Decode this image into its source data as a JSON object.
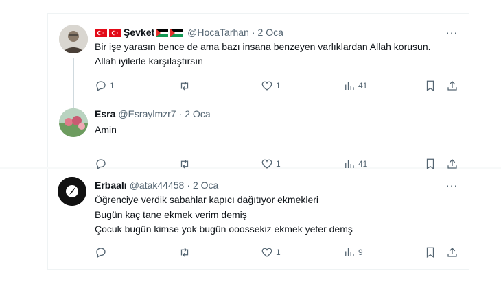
{
  "tweets": [
    {
      "name": "Şevket",
      "handle": "@HocaTarhan",
      "time": "2 Oca",
      "text": "Bir işe yarasın bence de ama bazı insana benzeyen varlıklardan Allah korusun. Allah iyilerle karşılaştırsın",
      "replies": "1",
      "retweets": "",
      "likes": "1",
      "views": "41",
      "more": "···"
    },
    {
      "name": "Esra",
      "handle": "@Esraylmzr7",
      "time": "2 Oca",
      "text": "Amin",
      "replies": "",
      "retweets": "",
      "likes": "1",
      "views": "41",
      "more": "···"
    },
    {
      "name": "Erbaalı",
      "handle": "@atak44458",
      "time": "2 Oca",
      "line1": "Öğrenciye verdik sabahlar kapıcı dağıtıyor ekmekleri",
      "line2": "Bugün kaç tane ekmek verim demiş",
      "line3": "Çocuk bugün kimse yok bugün ooossekiz ekmek yeter demş",
      "replies": "",
      "retweets": "",
      "likes": "1",
      "views": "9",
      "more": "···"
    }
  ],
  "dot": "·"
}
